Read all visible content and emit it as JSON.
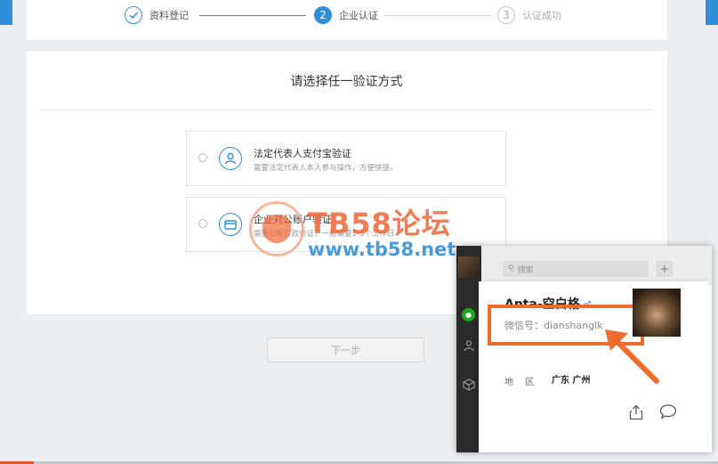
{
  "steps": [
    {
      "label": "资料登记",
      "state": "done",
      "marker": "check-icon"
    },
    {
      "label": "企业认证",
      "state": "active",
      "marker": "2"
    },
    {
      "label": "认证成功",
      "state": "todo",
      "marker": "3"
    }
  ],
  "main": {
    "title": "请选择任一验证方式",
    "options": [
      {
        "title": "法定代表人支付宝验证",
        "desc": "需要法定代表人本人参与操作，方便快捷。",
        "icon": "user-icon"
      },
      {
        "title": "企业对公账户验证",
        "desc": "需要公账打款验证，一般需要1-3个工作日。",
        "icon": "card-icon"
      }
    ],
    "next_label": "下一步"
  },
  "watermark": {
    "title": "TB58论坛",
    "url": "www.tb58.net"
  },
  "wechat": {
    "search_placeholder": "搜索",
    "plus": "+",
    "name": "Anta-空白格",
    "wechat_id": "微信号：dianshanglk",
    "region_label": "地 区",
    "region_value": "广东 广州"
  },
  "colors": {
    "accent": "#2e8fd8",
    "highlight": "#ec6d2d",
    "watermark_orange": "#ee6a3b",
    "watermark_blue": "#2a8ad6"
  }
}
